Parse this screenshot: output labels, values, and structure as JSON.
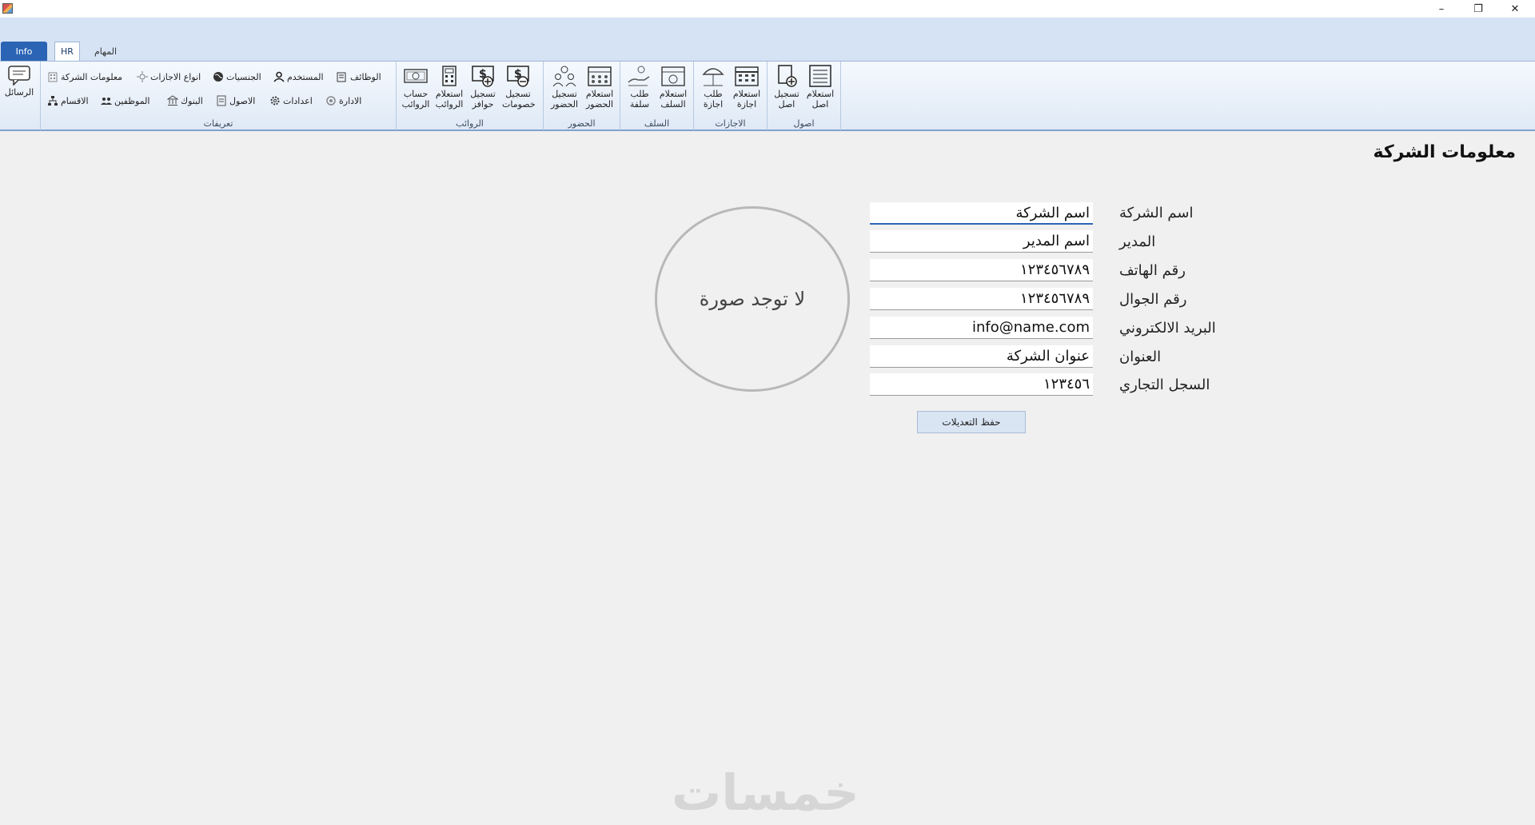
{
  "window": {
    "minimize": "–",
    "restore": "❐",
    "close": "✕"
  },
  "tabs": {
    "info": "Info",
    "hr": "HR",
    "tasks": "المهام"
  },
  "ribbon": {
    "messages": {
      "label": "الرسائل"
    },
    "definitions": {
      "group_label": "تعريفات",
      "row1": [
        "الوظائف",
        "المستخدم",
        "الجنسيات",
        "انواع الاجازات",
        "معلومات الشركة"
      ],
      "row2": [
        "الادارة",
        "اعدادات",
        "الاصول",
        "البنوك",
        "الموظفين",
        "الاقسام"
      ]
    },
    "salaries": {
      "group_label": "الروائب",
      "calc": "حساب الروائب",
      "query": "استعلام الروائب",
      "bonus": "تسجيل حوافز",
      "deduct": "تسجيل خصومات"
    },
    "attendance": {
      "group_label": "الحضور",
      "register": "تسجيل الحضور",
      "query": "استعلام الحضور"
    },
    "advances": {
      "group_label": "السلف",
      "request": "طلب سلفة",
      "query": "استعلام السلف"
    },
    "leaves": {
      "group_label": "الاجازات",
      "request": "طلب اجازة",
      "query": "استعلام اجازة"
    },
    "assets": {
      "group_label": "اصول",
      "register": "تسجيل اصل",
      "query": "استعلام اصل"
    }
  },
  "page": {
    "title": "معلومات الشركة",
    "fields": [
      {
        "label": "اسم الشركة",
        "value": "اسم الشركة"
      },
      {
        "label": "المدير",
        "value": "اسم المدير"
      },
      {
        "label": "رقم الهاتف",
        "value": "١٢٣٤٥٦٧٨٩"
      },
      {
        "label": "رقم الجوال",
        "value": "١٢٣٤٥٦٧٨٩"
      },
      {
        "label": "البريد الالكتروني",
        "value": "info@name.com"
      },
      {
        "label": "العنوان",
        "value": "عنوان الشركة"
      },
      {
        "label": "السجل التجاري",
        "value": "١٢٣٤٥٦"
      }
    ],
    "photo_placeholder": "لا توجد صورة",
    "save_button": "حفظ التعديلات",
    "watermark": "خمسات"
  },
  "colors": {
    "accent": "#2b64b5",
    "ribbon": "#d5e3f5"
  }
}
